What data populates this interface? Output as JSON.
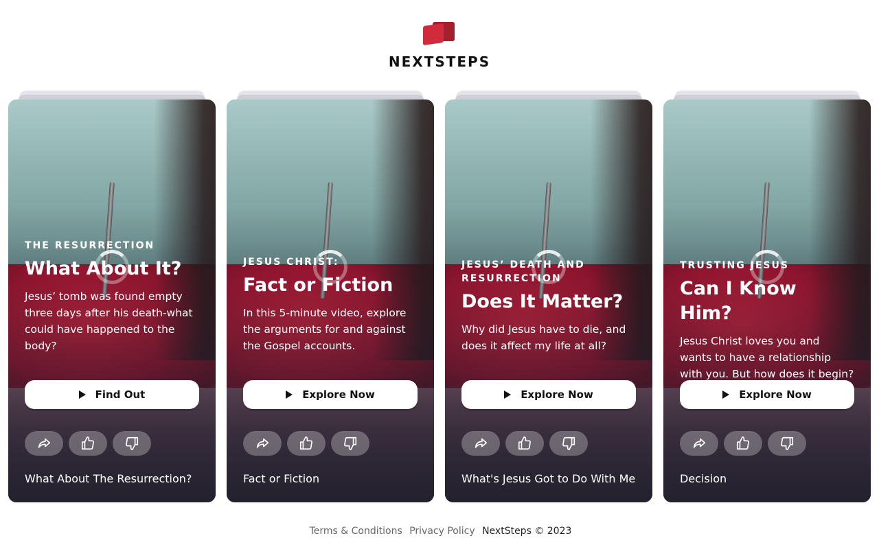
{
  "brand": {
    "name": "NEXTSTEPS",
    "logo_icon": "nextsteps-logo-icon",
    "colors": {
      "logo_primary": "#d12a3b",
      "logo_secondary": "#a3202e"
    }
  },
  "cards": [
    {
      "kicker": "THE RESURRECTION",
      "title": "What About It?",
      "description": "Jesus’ tomb was found empty three days after his death-what could have happened to the body?",
      "cta_label": "Find Out",
      "footer_title": "What About The Resurrection?"
    },
    {
      "kicker": "JESUS CHRIST:",
      "title": "Fact or Fiction",
      "description": "In this 5-minute video, explore the arguments for and against the Gospel accounts.",
      "cta_label": "Explore Now",
      "footer_title": "Fact or Fiction"
    },
    {
      "kicker": "JESUS’ DEATH AND RESURRECTION",
      "title": "Does It Matter?",
      "description": "Why did Jesus have to die, and does it affect my life at all?",
      "cta_label": "Explore Now",
      "footer_title": "What's Jesus Got to Do With Me"
    },
    {
      "kicker": "TRUSTING JESUS",
      "title": "Can I Know Him?",
      "description": "Jesus Christ loves you and wants to have a relationship with you. But how does it begin?",
      "cta_label": "Explore Now",
      "footer_title": "Decision"
    }
  ],
  "card_actions": {
    "share_icon": "share-icon",
    "like_icon": "thumbs-up-icon",
    "dislike_icon": "thumbs-down-icon",
    "cta_icon": "play-icon"
  },
  "footer": {
    "terms_label": "Terms & Conditions",
    "privacy_label": "Privacy Policy",
    "copyright": "NextSteps © 2023"
  }
}
